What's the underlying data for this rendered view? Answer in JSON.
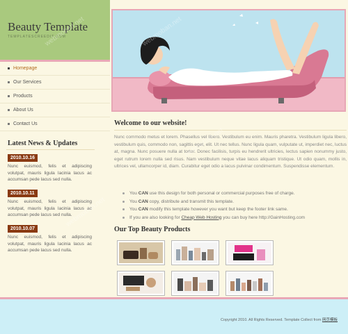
{
  "header": {
    "title": "Beauty Template",
    "subtitle": "TEMPLATESCREEDIT.COM"
  },
  "nav": {
    "items": [
      {
        "label": "Homepage",
        "active": true
      },
      {
        "label": "Our Services",
        "active": false
      },
      {
        "label": "Products",
        "active": false
      },
      {
        "label": "About Us",
        "active": false
      },
      {
        "label": "Contact Us",
        "active": false
      }
    ]
  },
  "news": {
    "title": "Latest News & Updates",
    "items": [
      {
        "date": "2010.10.16",
        "text": "Nunc euismod, felis et adipiscing volutpat, mauris ligula lacinia lacus ac accumsan pede lacus sed nulla."
      },
      {
        "date": "2010.10.11",
        "text": "Nunc euismod, felis et adipiscing volutpat, mauris ligula lacinia lacus ac accumsan pede lacus sed nulla."
      },
      {
        "date": "2010.10.07",
        "text": "Nunc euismod, felis et adipiscing volutpat, mauris ligula lacinia lacus ac accumsan pede lacus sed nulla."
      }
    ]
  },
  "welcome": {
    "title": "Welcome to our website!",
    "paragraph": "Nunc commodo metus et lorem. Phasellus vel libero. Vestibulum eu enim. Mauris pharetra. Vestibulum ligula libero, vestibulum quis, commodo non, sagittis eget, elit. Ut nec tellus. Nunc ligula quam, vulputate ut, imperdiet nec, luctus at, magna. Nunc posuere nulla at tortor. Donec facilisis, turpis eu hendrerit ultricies, lectus sapien nonummy justo, eget rutrum lorem nulla sed risus. Nam vestibulum neque vitae lacus aliquam tristique. Ut odio quam, mollis in, ultrices vel, ullamcorper id, diam. Curabitur eget odio a lacus pulvinar condimentum. Suspendisse elementum."
  },
  "bullets": [
    {
      "pre": "You ",
      "strong": "CAN",
      "post": " use this design for both personal or commercial purposes free of charge."
    },
    {
      "pre": "You ",
      "strong": "CAN",
      "post": " copy, distribute and transmit this template."
    },
    {
      "pre": "You ",
      "strong": "CAN",
      "post": " modify this template however you want but keep the footer link same."
    }
  ],
  "hosting": {
    "pre": "If you are also looking for ",
    "link": "Cheap Web Hosting",
    "post": " you can buy here http://GainHosting.com"
  },
  "products": {
    "title": "Our Top Beauty Products"
  },
  "footer": {
    "text": "Copyright 2010. All Rights Reserved. Template Collect from ",
    "link": "网页模板"
  },
  "watermarks": [
    "webmoban.net",
    "webmoban.net",
    "webmoban.net",
    "webmoban.net"
  ]
}
